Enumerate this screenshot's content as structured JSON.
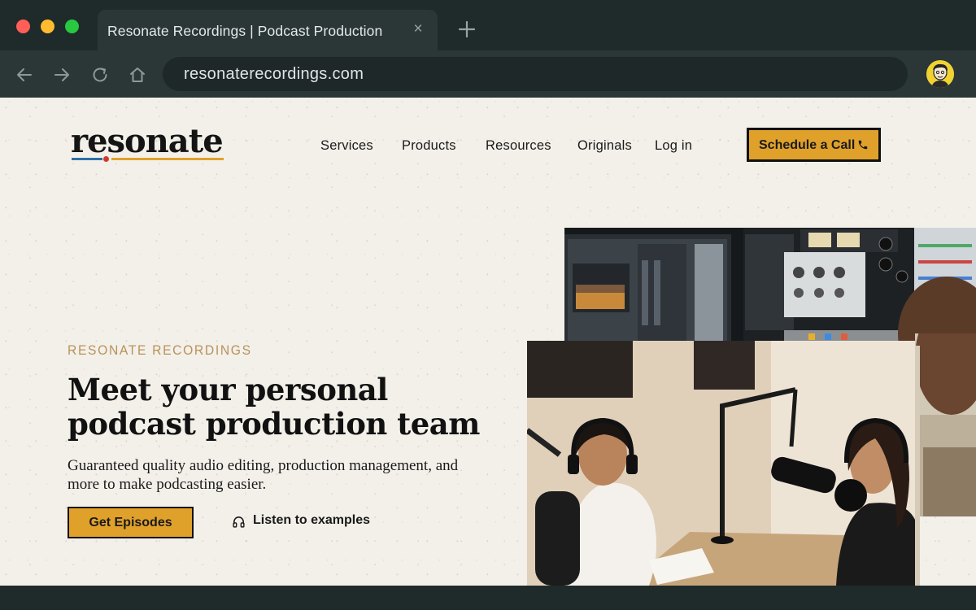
{
  "browser": {
    "tab_title": "Resonate Recordings | Podcast Production",
    "tab_close": "×",
    "url": "resonaterecordings.com"
  },
  "site": {
    "logo_text": "resonate",
    "nav": [
      {
        "label": "Services"
      },
      {
        "label": "Products"
      },
      {
        "label": "Resources"
      },
      {
        "label": "Originals"
      },
      {
        "label": "Log in"
      }
    ],
    "cta": "Schedule a Call"
  },
  "hero": {
    "eyebrow": "RESONATE RECORDINGS",
    "headline": "Meet your personal podcast production team",
    "subhead": "Guaranteed quality audio editing, production management, and more to make podcasting easier.",
    "primary_button": "Get Episodes",
    "secondary_link": "Listen to examples"
  },
  "colors": {
    "accent": "#e0a12b",
    "page_bg": "#f3f0ea",
    "chrome_bg": "#1f2a2a",
    "eyebrow": "#b8925a"
  },
  "icons": {
    "back": "arrow-left-icon",
    "forward": "arrow-right-icon",
    "reload": "reload-icon",
    "home": "home-icon",
    "phone": "phone-icon",
    "headphones": "headphones-icon"
  }
}
